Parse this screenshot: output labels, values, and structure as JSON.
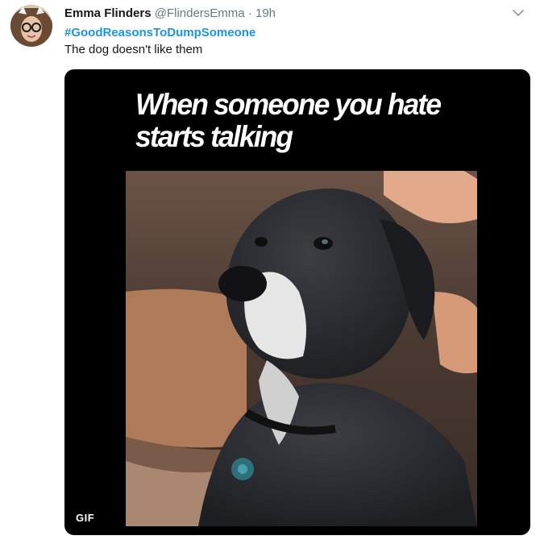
{
  "tweet": {
    "author": {
      "display_name": "Emma Flinders",
      "handle": "@FlindersEmma",
      "separator": "·",
      "timestamp": "19h"
    },
    "hashtag": "#GoodReasonsToDumpSomeone",
    "text": "The dog doesn't like them",
    "media": {
      "caption": "When someone you hate\nstarts talking",
      "badge": "GIF"
    }
  },
  "colors": {
    "link": "#1b95e0",
    "secondary_text": "#657786",
    "primary_text": "#14171a",
    "media_background": "#000000"
  },
  "icons": {
    "menu": "chevron-down-icon"
  }
}
